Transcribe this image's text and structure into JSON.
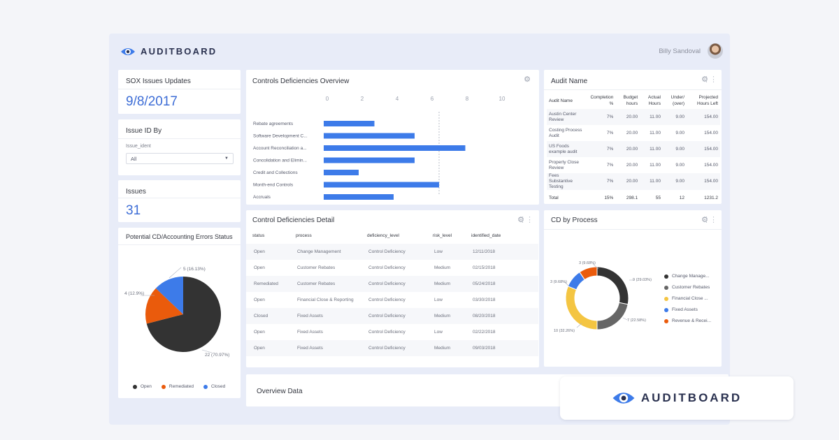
{
  "colors": {
    "accent_blue": "#3d7be9",
    "dark": "#333333",
    "orange": "#ea5b0c",
    "yellow": "#f4c542",
    "gray": "#666666",
    "text_blue": "#3d6dd6"
  },
  "header": {
    "brand": "AUDITBOARD",
    "user_name": "Billy Sandoval",
    "logo_icon": "auditboard-eye-icon",
    "avatar": "user-avatar"
  },
  "sox_card": {
    "title": "SOX Issues Updates",
    "date": "9/8/2017"
  },
  "issue_id_card": {
    "title": "Issue ID By",
    "field_label": "Issue_ident",
    "select_value": "All"
  },
  "issues_card": {
    "title": "Issues",
    "count": "31"
  },
  "status_pie": {
    "title": "Potential CD/Accounting Errors Status",
    "labels": {
      "open": "22 (70.97%)",
      "remediated": "5 (16.13%)",
      "closed": "4 (12.9%)"
    },
    "legend": [
      "Open",
      "Remediated",
      "Closed"
    ]
  },
  "controls_card": {
    "title": "Controls Deficiencies Overview"
  },
  "detail_card": {
    "title": "Control Deficiencies Detail",
    "columns": [
      "status",
      "process",
      "deficiency_level",
      "risk_level",
      "identified_date"
    ],
    "rows": [
      [
        "Open",
        "Change Management",
        "Control Deficiency",
        "Low",
        "12/11/2018"
      ],
      [
        "Open",
        "Customer Rebates",
        "Control Deficiency",
        "Medium",
        "02/15/2018"
      ],
      [
        "Remediated",
        "Customer Rebates",
        "Control Deficiency",
        "Medium",
        "05/24/2018"
      ],
      [
        "Open",
        "Financial Close & Reporting",
        "Control Deficiency",
        "Low",
        "03/30/2018"
      ],
      [
        "Closed",
        "Fixed Assets",
        "Control Deficiency",
        "Medium",
        "08/20/2018"
      ],
      [
        "Open",
        "Fixed Assets",
        "Control Deficiency",
        "Low",
        "02/22/2018"
      ],
      [
        "Open",
        "Fixed Assets",
        "Control Deficiency",
        "Medium",
        "09/03/2018"
      ]
    ]
  },
  "audit_card": {
    "title": "Audit Name",
    "columns": [
      "Audit Name",
      "Completion %",
      "Budget hours",
      "Actual Hours",
      "Under/ (over)",
      "Projected Hours Left"
    ],
    "rows": [
      [
        "Austin Center Review",
        "7%",
        "20.00",
        "11.00",
        "9.00",
        "154.00"
      ],
      [
        "Costing Process Audit",
        "7%",
        "20.00",
        "11.00",
        "9.00",
        "154.00"
      ],
      [
        "US Foods example audit",
        "7%",
        "20.00",
        "11.00",
        "9.00",
        "154.00"
      ],
      [
        "Property Close Review",
        "7%",
        "20.00",
        "11.00",
        "9.00",
        "154.00"
      ],
      [
        "Fees Substantive Testing",
        "7%",
        "20.00",
        "11.00",
        "9.00",
        "154.00"
      ]
    ],
    "total": [
      "Total",
      "15%",
      "298.1",
      "55",
      "12",
      "1231.2"
    ]
  },
  "cd_process_card": {
    "title": "CD by Process",
    "legend": [
      "Change Manage...",
      "Customer Rebates",
      "Financial Close ...",
      "Fixed Assets",
      "Revenue & Recei..."
    ],
    "labels": [
      "9 (29.03%)",
      "7 (22.58%)",
      "10 (32.26%)",
      "3 (9.68%)",
      "3 (9.68%)"
    ]
  },
  "overview_card": {
    "title": "Overview Data"
  },
  "overlay": {
    "brand": "AUDITBOARD"
  },
  "chart_data": [
    {
      "type": "bar",
      "orientation": "horizontal",
      "title": "Controls Deficiencies Overview",
      "categories": [
        "Rebate agreements",
        "Software Development C...",
        "Account Reconciliation a...",
        "Concolidation and Elimin...",
        "Credit and Collections",
        "Month-end Controls",
        "Accruals"
      ],
      "values": [
        2.9,
        5.2,
        8.1,
        5.2,
        2.0,
        6.6,
        4.0
      ],
      "xlim": [
        0,
        10
      ],
      "xticks": [
        "0",
        "2",
        "4",
        "6",
        "8",
        "10"
      ],
      "reference_line": 6.6,
      "color": "#3d7be9"
    },
    {
      "type": "pie",
      "title": "Potential CD/Accounting Errors Status",
      "series": [
        {
          "name": "Open",
          "value": 22,
          "color": "#333333"
        },
        {
          "name": "Remediated",
          "value": 5,
          "color": "#ea5b0c"
        },
        {
          "name": "Closed",
          "value": 4,
          "color": "#3d7be9"
        }
      ]
    },
    {
      "type": "pie",
      "title": "CD by Process",
      "donut": true,
      "series": [
        {
          "name": "Change Manage...",
          "value": 9,
          "color": "#333333"
        },
        {
          "name": "Customer Rebates",
          "value": 7,
          "color": "#666666"
        },
        {
          "name": "Financial Close ...",
          "value": 10,
          "color": "#f4c542"
        },
        {
          "name": "Fixed Assets",
          "value": 3,
          "color": "#3d7be9"
        },
        {
          "name": "Revenue & Recei...",
          "value": 3,
          "color": "#ea5b0c"
        }
      ]
    }
  ]
}
